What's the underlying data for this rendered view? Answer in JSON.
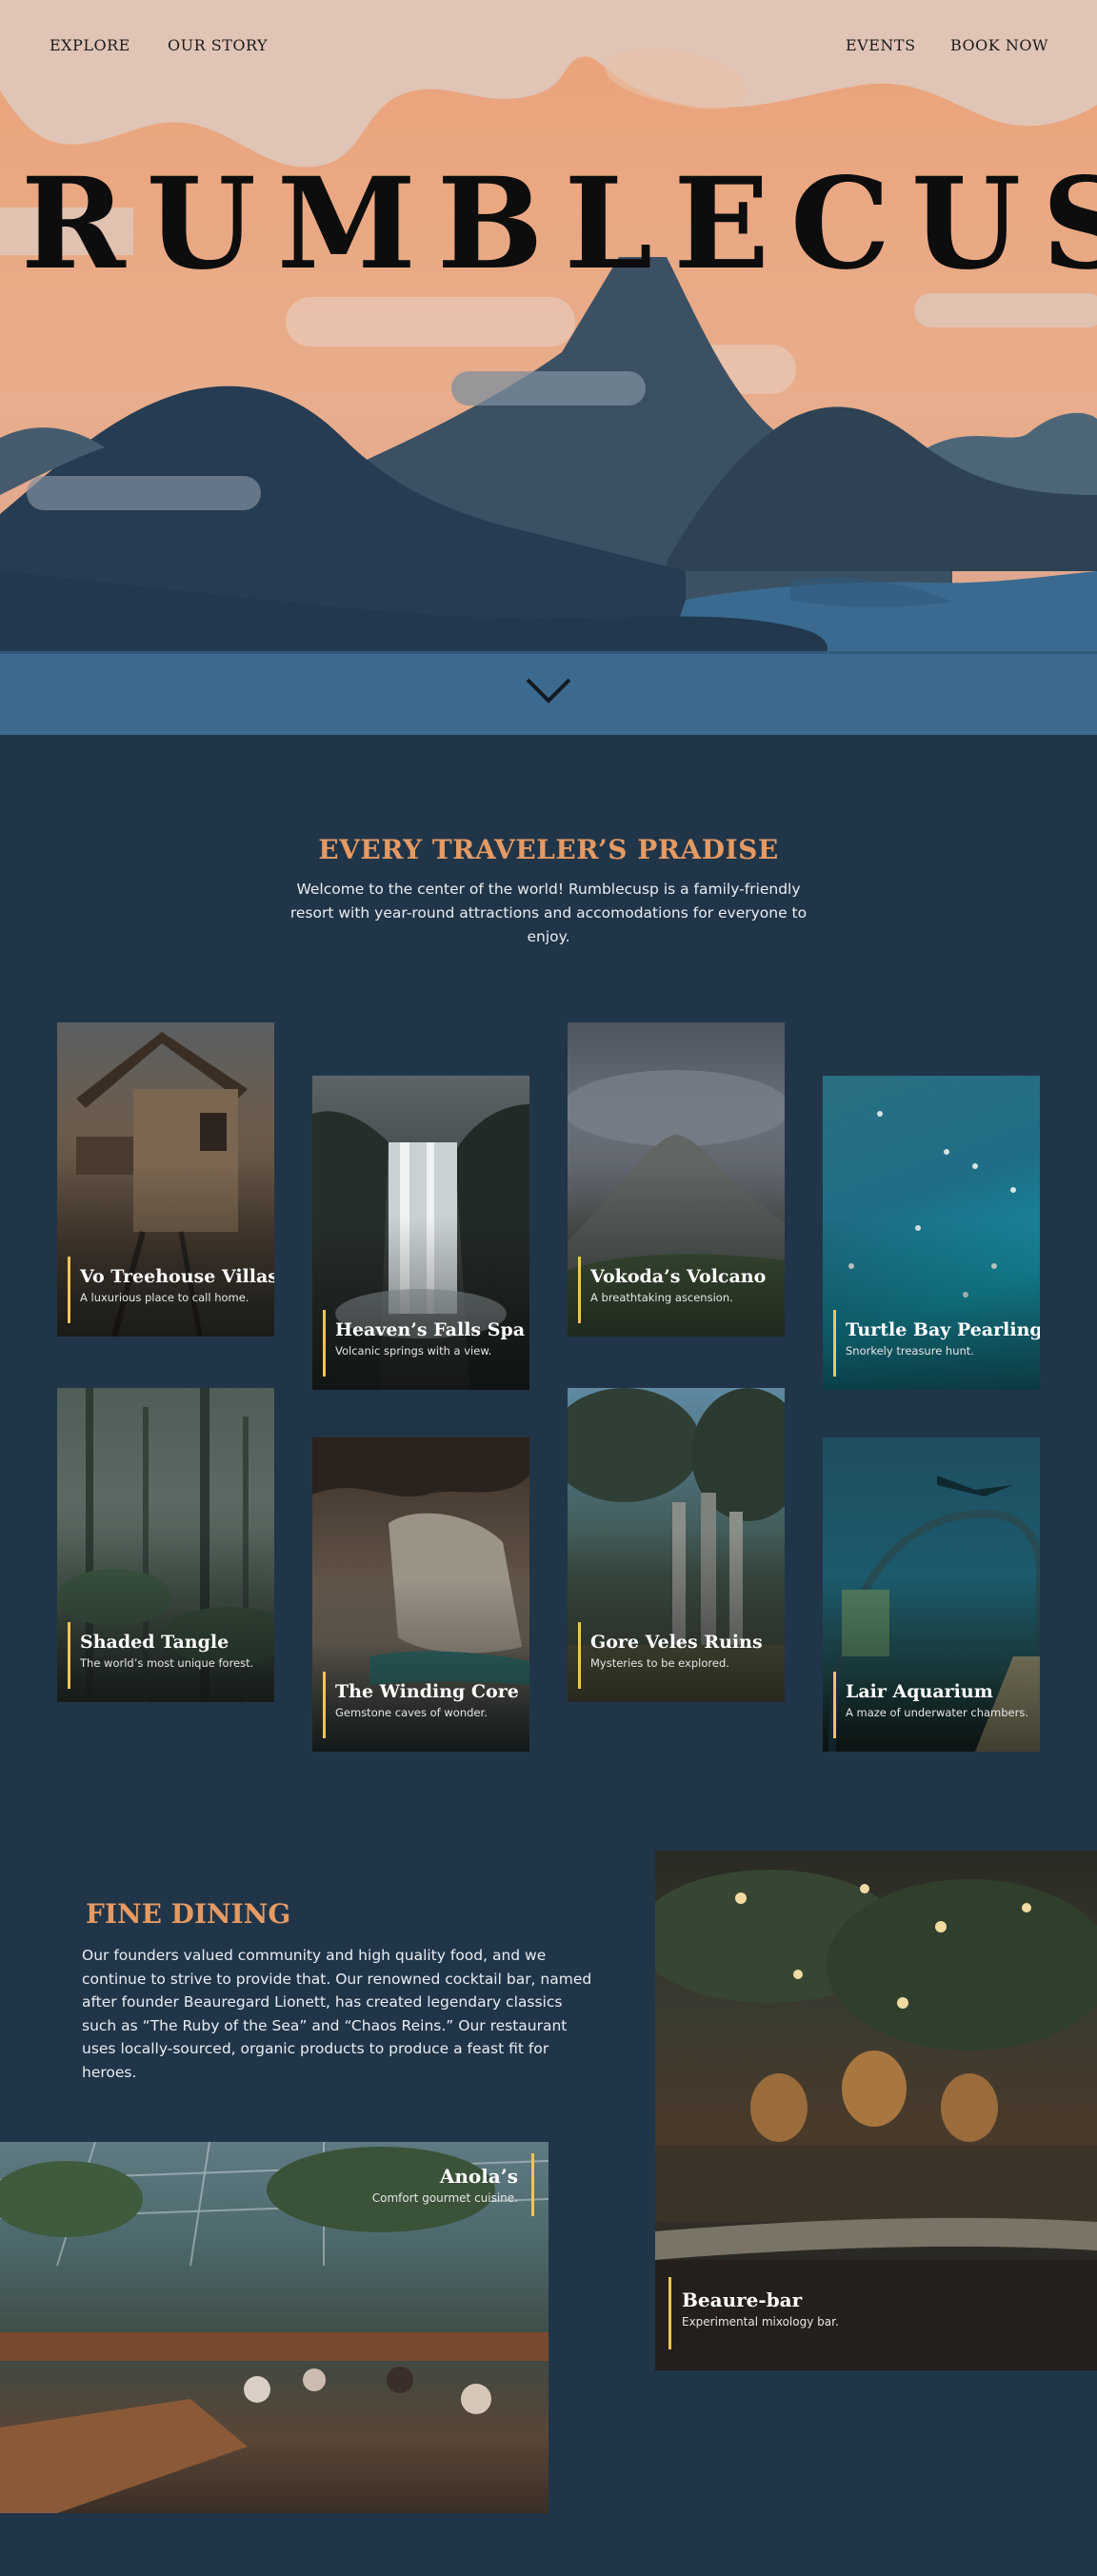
{
  "nav": {
    "explore": "EXPLORE",
    "our_story": "OUR STORY",
    "events": "EVENTS",
    "book_now": "BOOK NOW"
  },
  "hero": {
    "brand": "RUMBLECUSP",
    "scroll_icon": "chevron-down-icon"
  },
  "attractions": {
    "title": "EVERY TRAVELER’S PRADISE",
    "intro": "Welcome to the center of the world! Rumblecusp is a family-friendly resort with year-round attractions and accomodations for everyone to enjoy.",
    "cards": [
      {
        "title": "Vo Treehouse Villas",
        "subtitle": "A luxurious place to call home."
      },
      {
        "title": "Heaven’s Falls Spa",
        "subtitle": "Volcanic springs with a view."
      },
      {
        "title": "Vokoda’s Volcano",
        "subtitle": "A breathtaking ascension."
      },
      {
        "title": "Turtle Bay Pearling",
        "subtitle": "Snorkely treasure hunt."
      },
      {
        "title": "Shaded Tangle",
        "subtitle": "The world’s most unique forest."
      },
      {
        "title": "The Winding Core",
        "subtitle": "Gemstone caves of wonder."
      },
      {
        "title": "Gore Veles Ruins",
        "subtitle": "Mysteries to be explored."
      },
      {
        "title": "Lair Aquarium",
        "subtitle": "A maze of underwater chambers."
      }
    ]
  },
  "dining": {
    "title": "FINE DINING",
    "text": "Our founders valued community and high quality food, and we continue to strive to provide that. Our renowned cocktail bar, named after founder Beauregard Lionett, has created legendary classics such as “The Ruby of the Sea” and “Chaos Reins.” Our restaurant uses locally-sourced, organic products to produce a feast fit for heroes.",
    "bar": {
      "title": "Beaure-bar",
      "subtitle": "Experimental mixology bar."
    },
    "restaurant": {
      "title": "Anola’s",
      "subtitle": "Comfort gourmet cuisine."
    }
  },
  "colors": {
    "background": "#213549",
    "accent": "#e59a63",
    "highlight_bar": "#f1c35c",
    "sky": "#e6a57e",
    "water": "#3c6a8e"
  }
}
